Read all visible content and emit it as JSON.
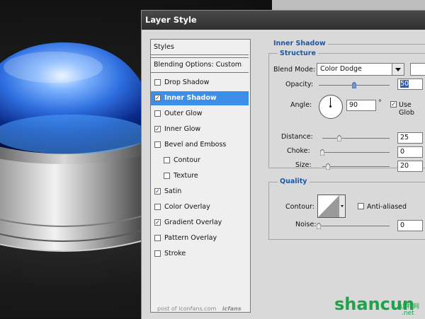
{
  "dialog": {
    "title": "Layer Style"
  },
  "left_panel": {
    "styles_label": "Styles",
    "blending_label": "Blending Options: Custom",
    "items": [
      {
        "label": "Drop Shadow",
        "checked": false
      },
      {
        "label": "Inner Shadow",
        "checked": true,
        "selected": true
      },
      {
        "label": "Outer Glow",
        "checked": false
      },
      {
        "label": "Inner Glow",
        "checked": true
      },
      {
        "label": "Bevel and Emboss",
        "checked": false
      },
      {
        "label": "Contour",
        "checked": false,
        "indent": true
      },
      {
        "label": "Texture",
        "checked": false,
        "indent": true
      },
      {
        "label": "Satin",
        "checked": true
      },
      {
        "label": "Color Overlay",
        "checked": false
      },
      {
        "label": "Gradient Overlay",
        "checked": true
      },
      {
        "label": "Pattern Overlay",
        "checked": false
      },
      {
        "label": "Stroke",
        "checked": false
      }
    ]
  },
  "inner_shadow": {
    "heading": "Inner Shadow",
    "structure": {
      "heading": "Structure",
      "blend_mode_label": "Blend Mode:",
      "blend_mode_value": "Color Dodge",
      "opacity_label": "Opacity:",
      "opacity_value": "50",
      "opacity_level": 0.5,
      "angle_label": "Angle:",
      "angle_value": "90",
      "degree_symbol": "°",
      "use_global_label": "Use Glob",
      "use_global_checked": true,
      "distance_label": "Distance:",
      "distance_value": "25",
      "distance_level": 0.25,
      "choke_label": "Choke:",
      "choke_value": "0",
      "choke_level": 0,
      "size_label": "Size:",
      "size_value": "20",
      "size_level": 0.08
    },
    "quality": {
      "heading": "Quality",
      "contour_label": "Contour:",
      "anti_aliased_label": "Anti-aliased",
      "anti_aliased_checked": false,
      "noise_label": "Noise:",
      "noise_value": "0",
      "noise_level": 0
    }
  },
  "credit": {
    "text": "post of iconfans.com",
    "brand": "icfans"
  },
  "watermark": {
    "text": "shancun",
    "suffix": ".net",
    "cn": "山村网"
  },
  "colors": {
    "selection": "#3b8fe8",
    "section_heading": "#1c56a8",
    "watermark": "#1ea24a"
  }
}
